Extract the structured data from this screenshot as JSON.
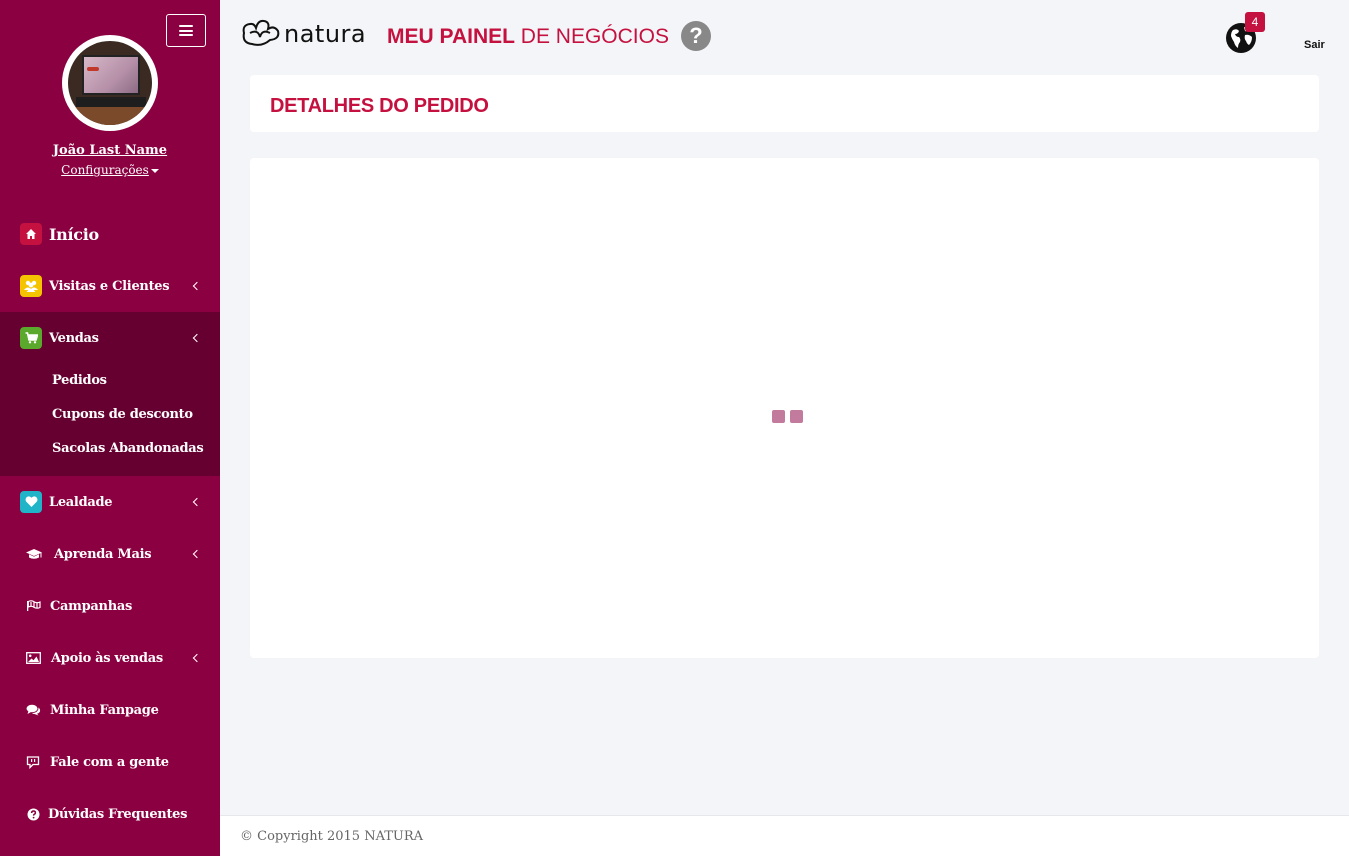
{
  "sidebar": {
    "toggle_icon": "hamburger-icon",
    "user": {
      "name": "João Last Name",
      "settings_label": "Configurações",
      "avatar_screen_text": "ubuntu"
    },
    "items": [
      {
        "label": "Início",
        "icon": "home-icon",
        "icon_bg": "#c4113f"
      },
      {
        "label": "Visitas e Clientes",
        "icon": "users-icon",
        "icon_bg": "#f5c400"
      },
      {
        "label": "Vendas",
        "icon": "cart-icon",
        "icon_bg": "#5aa82c",
        "expanded": true,
        "subitems": [
          "Pedidos",
          "Cupons de desconto",
          "Sacolas Abandonadas"
        ]
      },
      {
        "label": "Lealdade",
        "icon": "heart-icon",
        "icon_bg": "#20b4c8"
      },
      {
        "label": "Aprenda Mais",
        "icon": "graduation-cap-icon"
      },
      {
        "label": "Campanhas",
        "icon": "flag-icon"
      },
      {
        "label": "Apoio às vendas",
        "icon": "image-icon"
      },
      {
        "label": "Minha Fanpage",
        "icon": "comments-icon"
      },
      {
        "label": "Fale com a gente",
        "icon": "chat-icon"
      },
      {
        "label": "Dúvidas Frequentes",
        "icon": "question-circle-icon"
      }
    ]
  },
  "header": {
    "logo_text": "natura",
    "title_bold": "MEU PAINEL",
    "title_rest": " DE NEGÓCIOS",
    "help_label": "?",
    "notification_count": "4",
    "logout_label": "Sair"
  },
  "main": {
    "page_title": "DETALHES DO PEDIDO",
    "loading": true
  },
  "footer": {
    "copyright": "© Copyright 2015 NATURA"
  },
  "colors": {
    "sidebar_bg": "#8b0040",
    "sidebar_active_bg": "#660030",
    "accent": "#c4113f",
    "loader": "#c27b9c"
  }
}
